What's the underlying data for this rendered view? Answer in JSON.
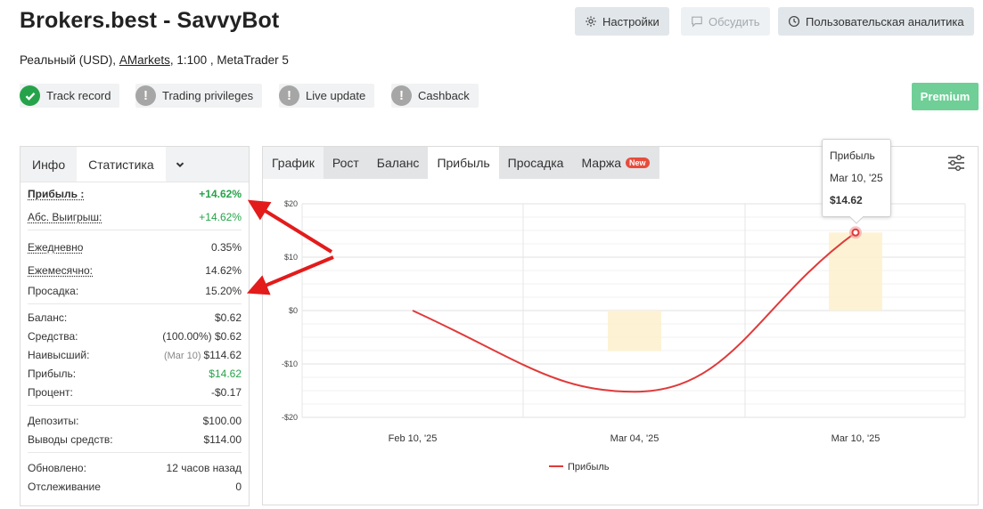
{
  "header": {
    "title": "Brokers.best - SavvyBot",
    "settings_label": "Настройки",
    "discuss_label": "Обсудить",
    "analytics_label": "Пользовательская аналитика"
  },
  "account": {
    "type": "Реальный (USD),",
    "broker": "AMarkets",
    "details": ", 1:100 , MetaTrader 5"
  },
  "badges": [
    {
      "label": "Track record",
      "status": "ok"
    },
    {
      "label": "Trading privileges",
      "status": "warn"
    },
    {
      "label": "Live update",
      "status": "warn"
    },
    {
      "label": "Cashback",
      "status": "warn"
    }
  ],
  "premium_label": "Premium",
  "left_tabs": {
    "info": "Инфо",
    "stats": "Статистика"
  },
  "stats": {
    "gain_label": "Прибыль :",
    "gain_value": "+14.62%",
    "abs_label": "Абс. Выигрыш:",
    "abs_value": "+14.62%",
    "daily_label": "Ежедневно",
    "daily_value": "0.35%",
    "monthly_label": "Ежемесячно:",
    "monthly_value": "14.62%",
    "drawdown_label": "Просадка:",
    "drawdown_value": "15.20%",
    "balance_label": "Баланс:",
    "balance_value": "$0.62",
    "equity_label": "Средства:",
    "equity_pct": "(100.00%)",
    "equity_value": "$0.62",
    "highest_label": "Наивысший:",
    "highest_date": "(Mar 10)",
    "highest_value": "$114.62",
    "profit_label": "Прибыль:",
    "profit_value": "$14.62",
    "interest_label": "Процент:",
    "interest_value": "-$0.17",
    "deposits_label": "Депозиты:",
    "deposits_value": "$100.00",
    "withdrawals_label": "Выводы средств:",
    "withdrawals_value": "$114.00",
    "updated_label": "Обновлено:",
    "updated_value": "12 часов назад",
    "tracking_label": "Отслеживание",
    "tracking_value": "0"
  },
  "chart_tabs": [
    {
      "label": "График",
      "style": "normal"
    },
    {
      "label": "Рост",
      "style": "alt"
    },
    {
      "label": "Баланс",
      "style": "alt"
    },
    {
      "label": "Прибыль",
      "style": "active"
    },
    {
      "label": "Просадка",
      "style": "alt"
    },
    {
      "label": "Маржа",
      "style": "alt",
      "badge": "New"
    }
  ],
  "tooltip": {
    "title": "Прибыль",
    "date": "Mar 10, '25",
    "value": "$14.62"
  },
  "chart_data": {
    "type": "line",
    "series": [
      {
        "name": "Прибыль",
        "color": "#e03a3a",
        "x": [
          "Feb 10, '25",
          "Mar 04, '25",
          "Mar 10, '25"
        ],
        "values": [
          0,
          -15.2,
          14.62
        ]
      }
    ],
    "y_ticks": [
      "$20",
      "$10",
      "$0",
      "-$10",
      "-$20"
    ],
    "y_tick_values": [
      20,
      10,
      0,
      -10,
      -20
    ],
    "x_ticks": [
      "Feb 10, '25",
      "Mar 04, '25",
      "Mar 10, '25"
    ],
    "ylim": [
      -20,
      20
    ],
    "bars": [
      {
        "x": "Mar 04, '25",
        "value": -7.6
      },
      {
        "x": "Mar 10, '25",
        "value": 14.62
      }
    ],
    "legend": "bottom-center",
    "grid": true
  }
}
